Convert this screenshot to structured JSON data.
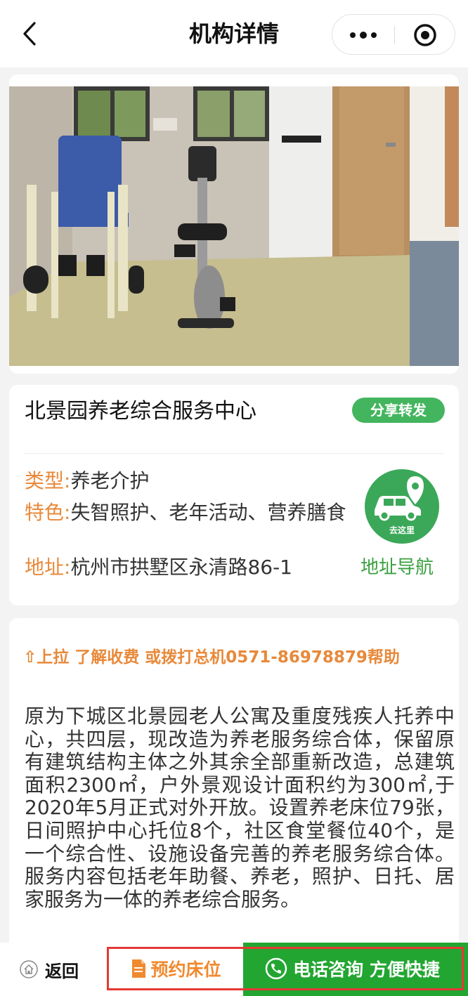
{
  "nav": {
    "title": "机构详情"
  },
  "gallery": {
    "slide_count": 4,
    "active_index": 1
  },
  "org": {
    "name": "北景园养老综合服务中心",
    "share_label": "分享转发",
    "type_key": "类型:",
    "type_value": "养老介护",
    "feature_key": "特色:",
    "feature_value": "失智照护、老年活动、营养膳食",
    "address_key": "地址:",
    "address_value": "杭州市拱墅区永清路86-1",
    "go_label": "去这里",
    "navigate_label": "地址导航"
  },
  "info": {
    "hint": "⇧上拉 了解收费 或拨打总机0571-86978879帮助",
    "description": "原为下城区北景园老人公寓及重度残疾人托养中心，共四层，现改造为养老服务综合体，保留原有建筑结构主体之外其余全部重新改造，总建筑面积2300㎡，户外景观设计面积约为300㎡,于2020年5月正式对外开放。设置养老床位79张，日间照护中心托位8个，社区食堂餐位40个，是一个综合性、设施设备完善的养老服务综合体。服务内容包括老年助餐、养老，照护、日托、居家服务为一体的养老综合服务。"
  },
  "bottom": {
    "back_label": "返回",
    "book_label": "预约床位",
    "call_label": "电话咨询 方便快捷"
  },
  "colors": {
    "accent_orange": "#e8893a",
    "brand_green": "#22a631",
    "highlight_red": "#e53935"
  }
}
